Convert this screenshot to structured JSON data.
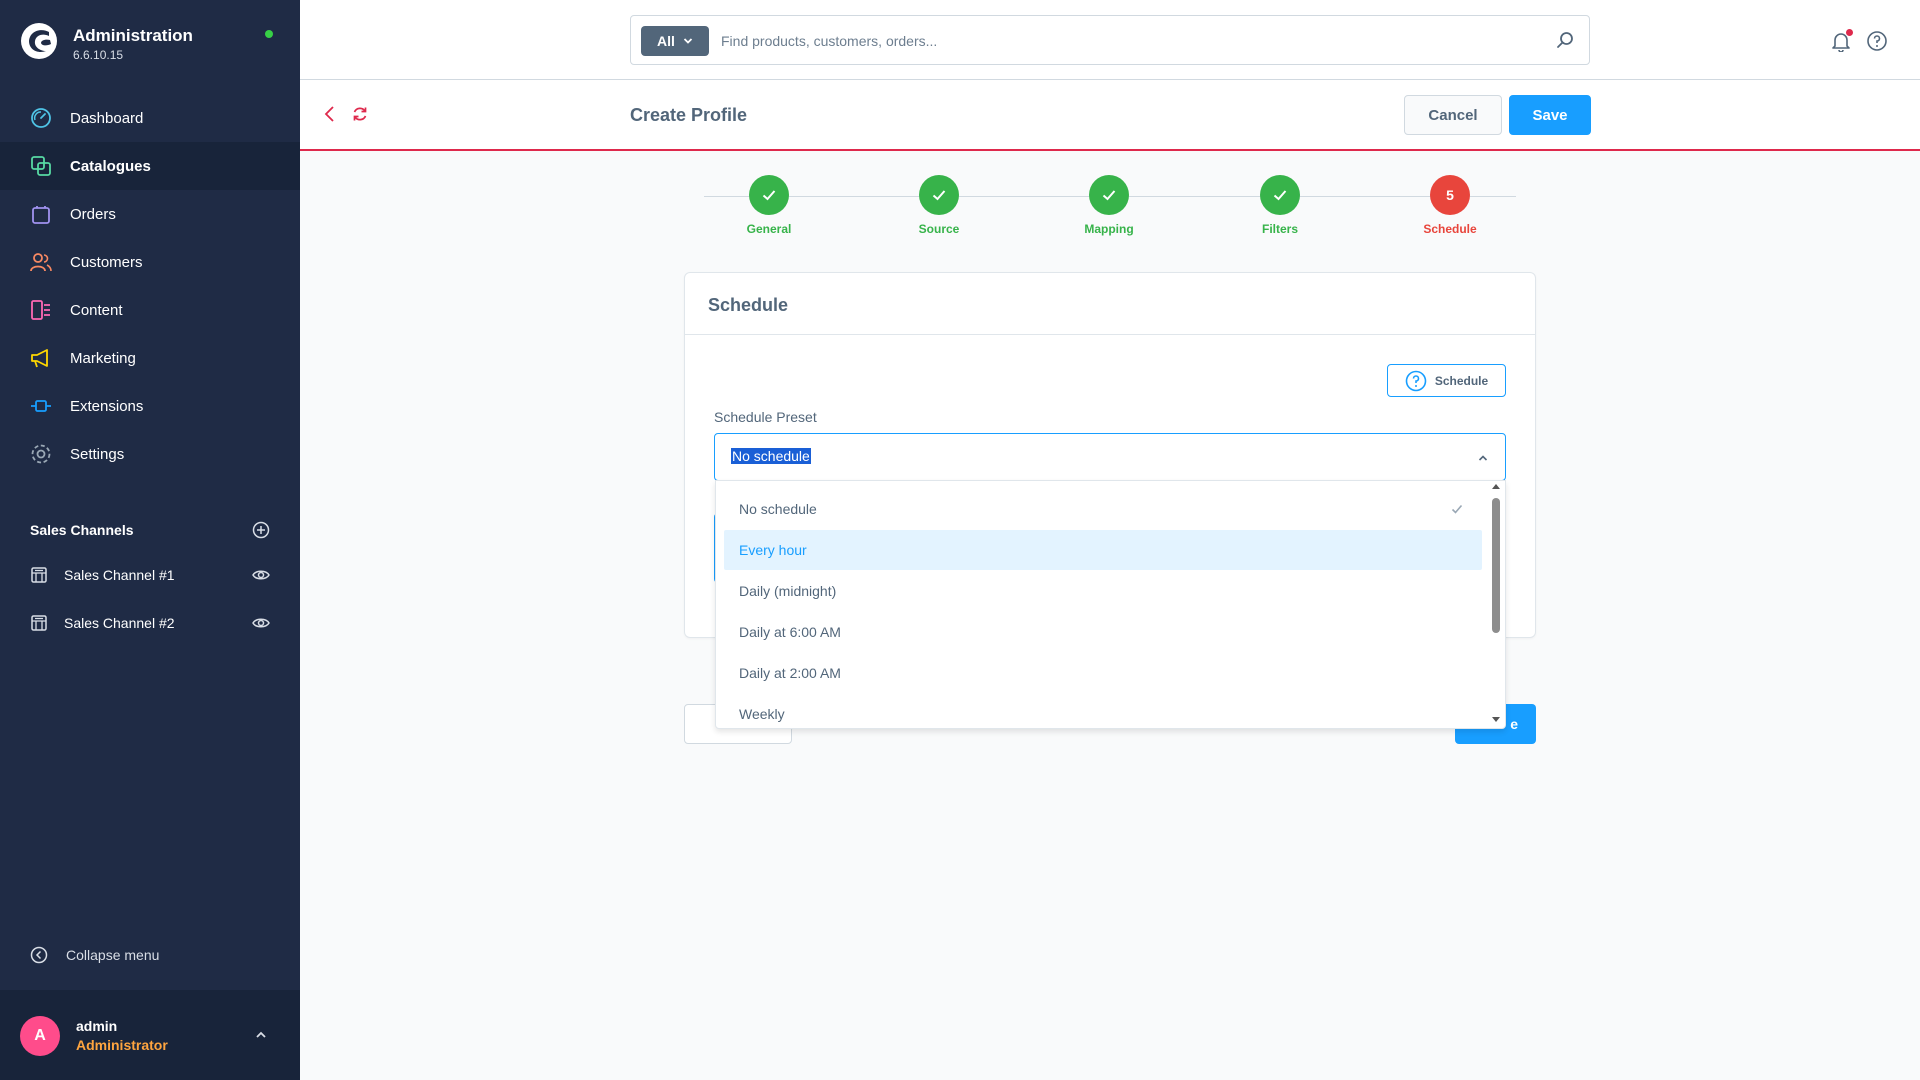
{
  "app": {
    "title": "Administration",
    "version": "6.6.10.15"
  },
  "colors": {
    "sidebar_bg": "#1f2b45",
    "accent": "#189eff",
    "success": "#37b34a",
    "danger": "#e8453c",
    "status_online": "#37d046"
  },
  "sidebar": {
    "items": [
      {
        "label": "Dashboard",
        "icon": "dashboard-icon",
        "color": "#4fc4e6"
      },
      {
        "label": "Catalogues",
        "icon": "catalogues-icon",
        "color": "#57d9a3"
      },
      {
        "label": "Orders",
        "icon": "orders-icon",
        "color": "#a092f0"
      },
      {
        "label": "Customers",
        "icon": "customers-icon",
        "color": "#f88962"
      },
      {
        "label": "Content",
        "icon": "content-icon",
        "color": "#ff68b4"
      },
      {
        "label": "Marketing",
        "icon": "marketing-icon",
        "color": "#ffd700"
      },
      {
        "label": "Extensions",
        "icon": "extensions-icon",
        "color": "#189eff"
      },
      {
        "label": "Settings",
        "icon": "settings-icon",
        "color": "#9aa8b5"
      }
    ],
    "active_index": 1,
    "sales_channels_title": "Sales Channels",
    "sales_channels": [
      {
        "label": "Sales Channel #1"
      },
      {
        "label": "Sales Channel #2"
      }
    ],
    "collapse_label": "Collapse menu",
    "user": {
      "initial": "A",
      "name": "admin",
      "role": "Administrator"
    }
  },
  "topbar": {
    "search_type": "All",
    "search_placeholder": "Find products, customers, orders..."
  },
  "page": {
    "title": "Create Profile",
    "cancel_label": "Cancel",
    "save_label": "Save"
  },
  "stepper": {
    "steps": [
      {
        "label": "General",
        "state": "done"
      },
      {
        "label": "Source",
        "state": "done"
      },
      {
        "label": "Mapping",
        "state": "done"
      },
      {
        "label": "Filters",
        "state": "done"
      },
      {
        "label": "Schedule",
        "state": "current",
        "number": "5"
      }
    ]
  },
  "card": {
    "title": "Schedule",
    "help_button_label": "Schedule",
    "field_label": "Schedule Preset",
    "selected_value": "No schedule",
    "next_button_partial": "e"
  },
  "dropdown": {
    "options": [
      {
        "label": "No schedule",
        "selected": true
      },
      {
        "label": "Every hour",
        "hover": true
      },
      {
        "label": "Daily (midnight)"
      },
      {
        "label": "Daily at 6:00 AM"
      },
      {
        "label": "Daily at 2:00 AM"
      },
      {
        "label": "Weekly"
      }
    ]
  }
}
